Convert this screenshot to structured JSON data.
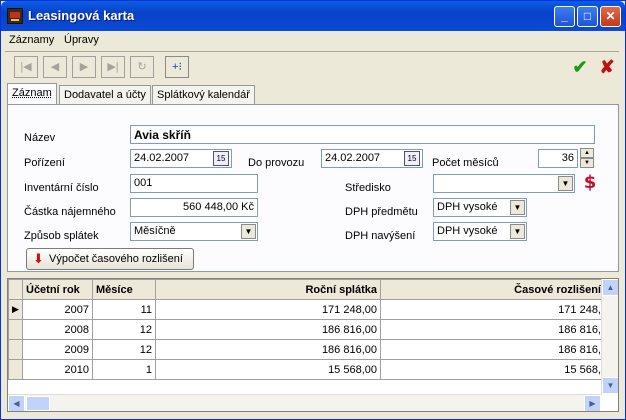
{
  "window": {
    "title": "Leasingová karta"
  },
  "titlebar_buttons": {
    "minimize": "_",
    "maximize": "□",
    "close": "✕"
  },
  "menu": [
    "Záznamy",
    "Úpravy"
  ],
  "tabs": [
    "Záznam",
    "Dodavatel a účty",
    "Splátkový kalendář"
  ],
  "form": {
    "nazev_label": "Název",
    "nazev_value": "Avia skříň",
    "porizeni_label": "Pořízení",
    "porizeni_value": "24.02.2007",
    "do_provozu_label": "Do provozu",
    "do_provozu_value": "24.02.2007",
    "pocet_mesicu_label": "Počet měsíců",
    "pocet_mesicu_value": "36",
    "inventarni_cislo_label": "Inventární číslo",
    "inventarni_cislo_value": "001",
    "stredisko_label": "Středisko",
    "stredisko_value": "",
    "castka_label": "Částka nájemného",
    "castka_value": "560 448,00 Kč",
    "dph_predmetu_label": "DPH předmětu",
    "dph_predmetu_value": "DPH vysoké",
    "zpusob_splatek_label": "Způsob splátek",
    "zpusob_splatek_value": "Měsíčně",
    "dph_navyseni_label": "DPH navýšení",
    "dph_navyseni_value": "DPH vysoké",
    "calendar_glyph": "15",
    "calc_button": "Výpočet časového rozlišení"
  },
  "table": {
    "headers": [
      "Účetní rok",
      "Měsíce",
      "Roční splátka",
      "Časové rozlišení"
    ],
    "rows": [
      [
        "2007",
        "11",
        "171 248,00",
        "171 248,"
      ],
      [
        "2008",
        "12",
        "186 816,00",
        "186 816,"
      ],
      [
        "2009",
        "12",
        "186 816,00",
        "186 816,"
      ],
      [
        "2010",
        "1",
        "15 568,00",
        "15 568,"
      ]
    ]
  }
}
